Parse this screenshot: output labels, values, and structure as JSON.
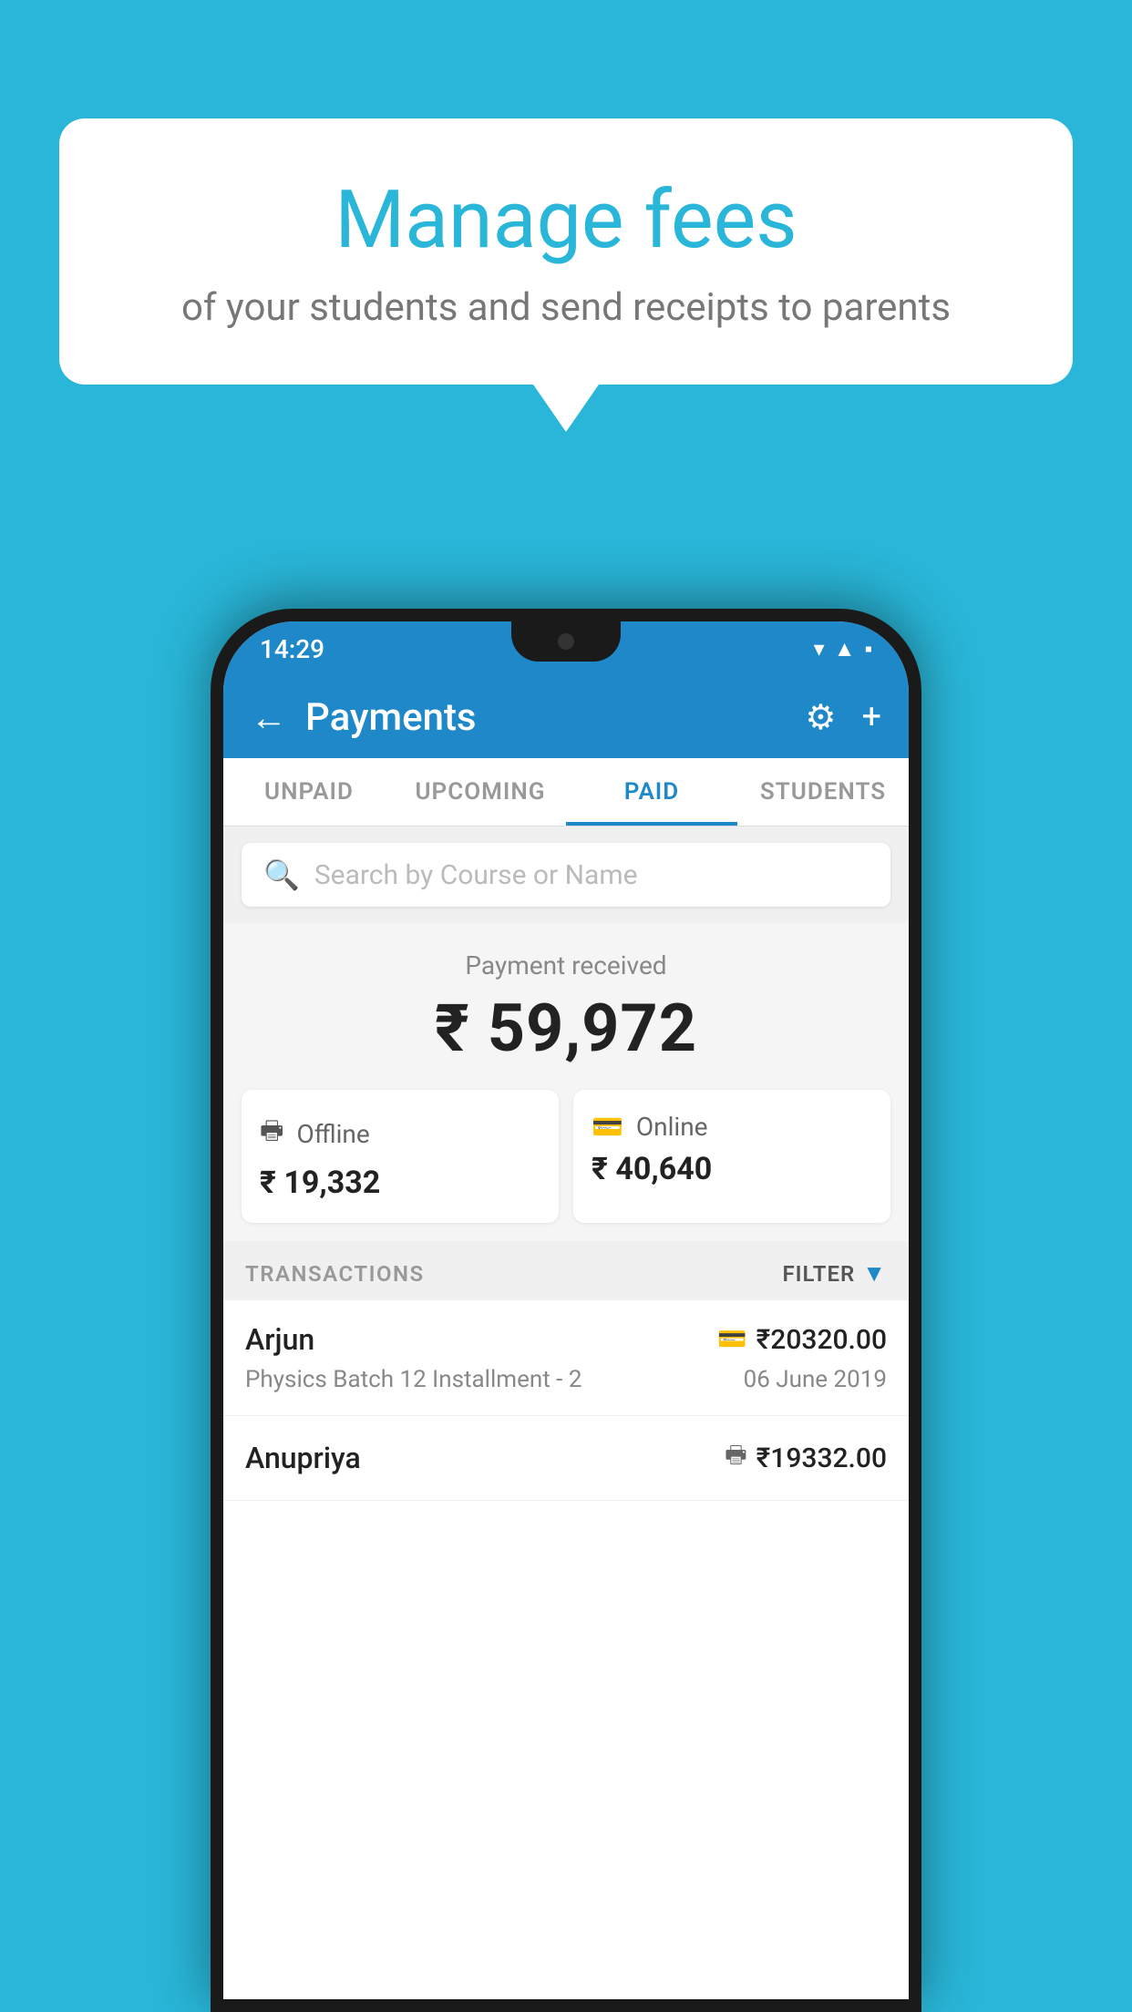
{
  "background_color": "#29b6d8",
  "speech_bubble": {
    "title": "Manage fees",
    "subtitle": "of your students and send receipts to parents"
  },
  "phone": {
    "status_bar": {
      "time": "14:29",
      "icons": [
        "wifi",
        "signal",
        "battery"
      ]
    },
    "app_header": {
      "title": "Payments",
      "back_label": "←",
      "settings_label": "⚙",
      "add_label": "+"
    },
    "tabs": [
      {
        "label": "UNPAID",
        "active": false
      },
      {
        "label": "UPCOMING",
        "active": false
      },
      {
        "label": "PAID",
        "active": true
      },
      {
        "label": "STUDENTS",
        "active": false
      }
    ],
    "search": {
      "placeholder": "Search by Course or Name"
    },
    "payment_received": {
      "label": "Payment received",
      "amount": "₹ 59,972"
    },
    "payment_cards": [
      {
        "type": "offline",
        "icon": "💳",
        "label": "Offline",
        "amount": "₹ 19,332"
      },
      {
        "type": "online",
        "icon": "💳",
        "label": "Online",
        "amount": "₹ 40,640"
      }
    ],
    "transactions": {
      "label": "TRANSACTIONS",
      "filter_label": "FILTER",
      "rows": [
        {
          "name": "Arjun",
          "amount": "₹20320.00",
          "course": "Physics Batch 12 Installment - 2",
          "date": "06 June 2019",
          "payment_type": "online"
        },
        {
          "name": "Anupriya",
          "amount": "₹19332.00",
          "course": "",
          "date": "",
          "payment_type": "offline"
        }
      ]
    }
  }
}
